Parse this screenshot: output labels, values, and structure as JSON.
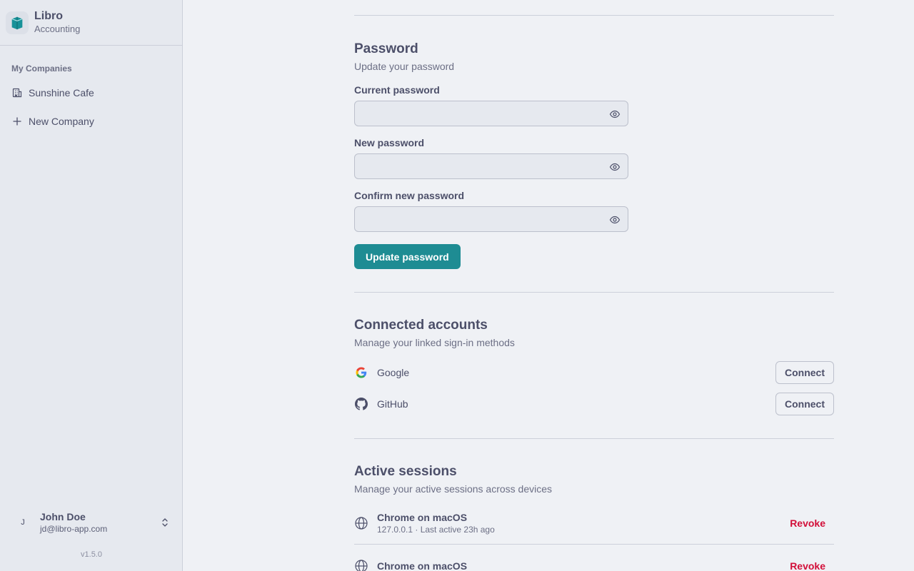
{
  "brand": {
    "name": "Libro",
    "subtitle": "Accounting"
  },
  "sidebar": {
    "heading": "My Companies",
    "items": [
      {
        "label": "Sunshine Cafe",
        "icon": "building-icon"
      },
      {
        "label": "New Company",
        "icon": "plus-icon"
      }
    ]
  },
  "user": {
    "initial": "J",
    "name": "John Doe",
    "email": "jd@libro-app.com"
  },
  "version": "v1.5.0",
  "password": {
    "title": "Password",
    "description": "Update your password",
    "current_label": "Current password",
    "new_label": "New password",
    "confirm_label": "Confirm new password",
    "current_value": "",
    "new_value": "",
    "confirm_value": "",
    "button": "Update password"
  },
  "connected": {
    "title": "Connected accounts",
    "description": "Manage your linked sign-in methods",
    "accounts": [
      {
        "name": "Google",
        "button": "Connect",
        "icon": "google-icon"
      },
      {
        "name": "GitHub",
        "button": "Connect",
        "icon": "github-icon"
      }
    ]
  },
  "sessions": {
    "title": "Active sessions",
    "description": "Manage your active sessions across devices",
    "items": [
      {
        "title": "Chrome on macOS",
        "meta": "127.0.0.1 · Last active 23h ago",
        "button": "Revoke",
        "icon": "globe-icon"
      },
      {
        "title": "Chrome on macOS",
        "meta": "",
        "button": "Revoke",
        "icon": "globe-icon"
      }
    ]
  },
  "colors": {
    "accent": "#1e8c93",
    "danger": "#d20f39",
    "background": "#eff1f5",
    "sidebar": "#e6e9ef"
  }
}
